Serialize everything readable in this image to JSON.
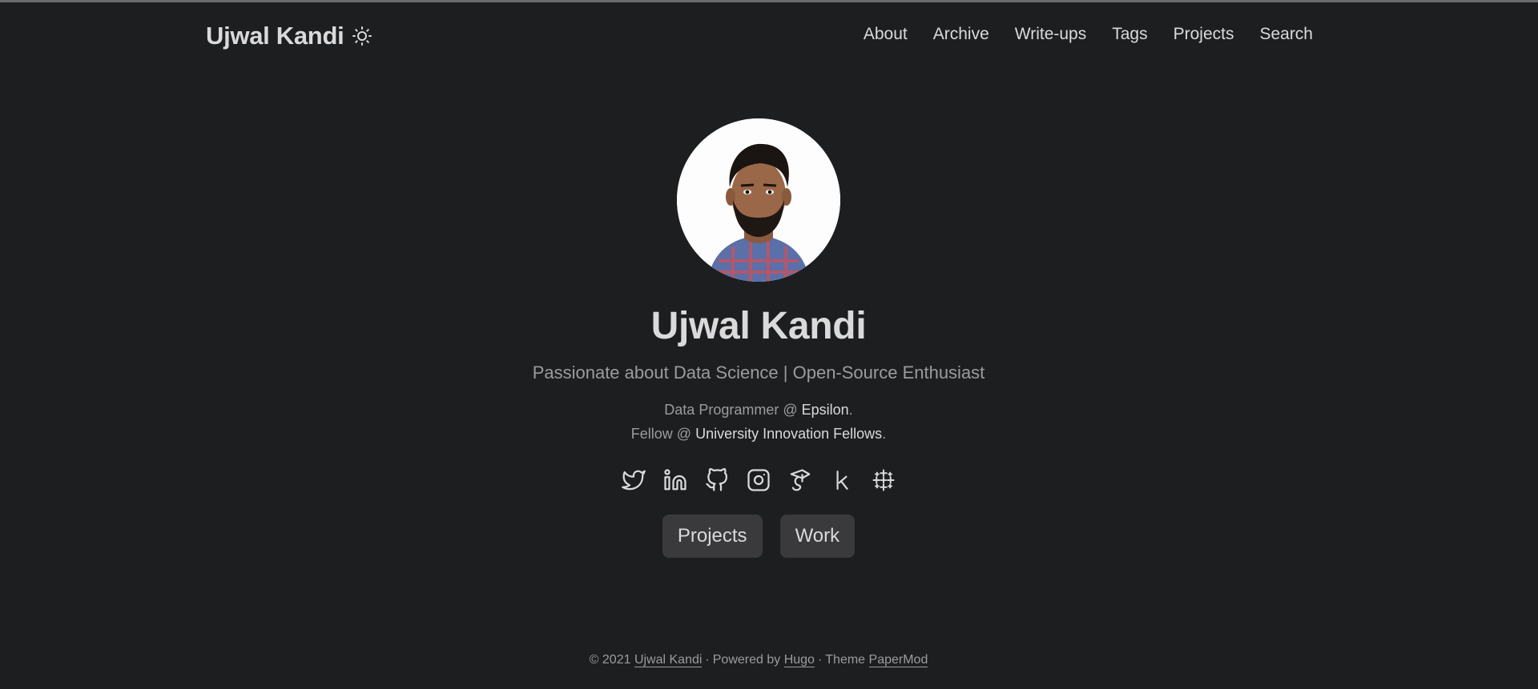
{
  "site": {
    "logo_text": "Ujwal Kandi",
    "theme_toggle_icon": "sun-icon"
  },
  "nav": [
    {
      "label": "About"
    },
    {
      "label": "Archive"
    },
    {
      "label": "Write-ups"
    },
    {
      "label": "Tags"
    },
    {
      "label": "Projects"
    },
    {
      "label": "Search"
    }
  ],
  "profile": {
    "name": "Ujwal Kandi",
    "subtitle": "Passionate about Data Science | Open-Source Enthusiast",
    "line1_prefix": "Data Programmer @ ",
    "line1_link": "Epsilon",
    "line1_suffix": ".",
    "line2_prefix": "Fellow @ ",
    "line2_link": "University Innovation Fellows",
    "line2_suffix": "."
  },
  "social": [
    {
      "icon": "twitter-icon"
    },
    {
      "icon": "linkedin-icon"
    },
    {
      "icon": "github-icon"
    },
    {
      "icon": "instagram-icon"
    },
    {
      "icon": "google-scholar-icon"
    },
    {
      "icon": "kaggle-icon"
    },
    {
      "icon": "tableau-icon"
    }
  ],
  "buttons": {
    "projects_label": "Projects",
    "work_label": "Work"
  },
  "footer": {
    "copyright": "© 2021 ",
    "author_link": "Ujwal Kandi",
    "powered_prefix": "Powered by ",
    "hugo_link": "Hugo",
    "theme_prefix": "Theme ",
    "theme_link": "PaperMod",
    "sep": "·"
  },
  "colors": {
    "background": "#1d1e20",
    "text": "#dadadb",
    "muted": "#9b9c9d",
    "button_bg": "#3a3a3c"
  }
}
